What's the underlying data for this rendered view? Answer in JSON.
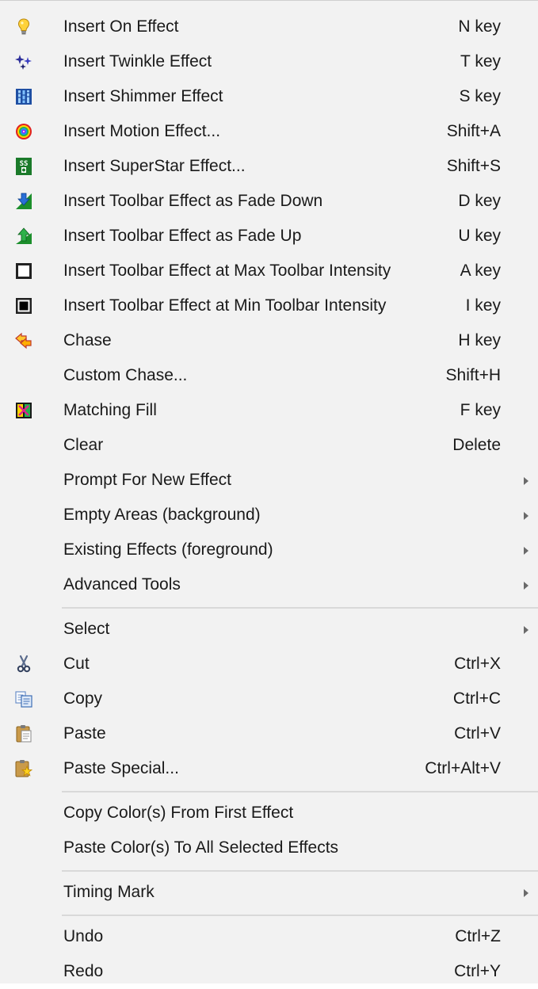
{
  "colors": {
    "menu_bg": "#f2f2f2",
    "text": "#1a1a1a",
    "separator": "#d9d9d9",
    "arrow": "#6a6a6a"
  },
  "items": [
    {
      "label": "Insert On Effect",
      "shortcut": "N key",
      "icon": "lightbulb-icon"
    },
    {
      "label": "Insert Twinkle Effect",
      "shortcut": "T key",
      "icon": "twinkle-icon"
    },
    {
      "label": "Insert Shimmer Effect",
      "shortcut": "S key",
      "icon": "shimmer-icon"
    },
    {
      "label": "Insert Motion Effect...",
      "shortcut": "Shift+A",
      "icon": "motion-icon"
    },
    {
      "label": "Insert SuperStar Effect...",
      "shortcut": "Shift+S",
      "icon": "superstar-icon"
    },
    {
      "label": "Insert Toolbar Effect as Fade Down",
      "shortcut": "D key",
      "icon": "fade-down-icon"
    },
    {
      "label": "Insert Toolbar Effect as Fade Up",
      "shortcut": "U key",
      "icon": "fade-up-icon"
    },
    {
      "label": "Insert Toolbar Effect at Max Toolbar Intensity",
      "shortcut": "A key",
      "icon": "max-intensity-icon"
    },
    {
      "label": "Insert Toolbar Effect at Min Toolbar Intensity",
      "shortcut": "I key",
      "icon": "min-intensity-icon"
    },
    {
      "label": "Chase",
      "shortcut": "H key",
      "icon": "chase-icon"
    },
    {
      "label": "Custom Chase...",
      "shortcut": "Shift+H"
    },
    {
      "label": "Matching Fill",
      "shortcut": "F key",
      "icon": "matching-fill-icon"
    },
    {
      "label": "Clear",
      "shortcut": "Delete"
    },
    {
      "label": "Prompt For New Effect",
      "submenu": true
    },
    {
      "label": "Empty Areas (background)",
      "submenu": true
    },
    {
      "label": "Existing Effects (foreground)",
      "submenu": true
    },
    {
      "label": "Advanced Tools",
      "submenu": true
    },
    {
      "separator": true
    },
    {
      "label": "Select",
      "submenu": true
    },
    {
      "label": "Cut",
      "shortcut": "Ctrl+X",
      "icon": "cut-icon"
    },
    {
      "label": "Copy",
      "shortcut": "Ctrl+C",
      "icon": "copy-icon"
    },
    {
      "label": "Paste",
      "shortcut": "Ctrl+V",
      "icon": "paste-icon"
    },
    {
      "label": "Paste Special...",
      "shortcut": "Ctrl+Alt+V",
      "icon": "paste-special-icon"
    },
    {
      "separator": true
    },
    {
      "label": "Copy Color(s) From First Effect"
    },
    {
      "label": "Paste Color(s) To All Selected Effects"
    },
    {
      "separator": true
    },
    {
      "label": "Timing Mark",
      "submenu": true
    },
    {
      "separator": true
    },
    {
      "label": "Undo",
      "shortcut": "Ctrl+Z"
    },
    {
      "label": "Redo",
      "shortcut": "Ctrl+Y"
    }
  ]
}
